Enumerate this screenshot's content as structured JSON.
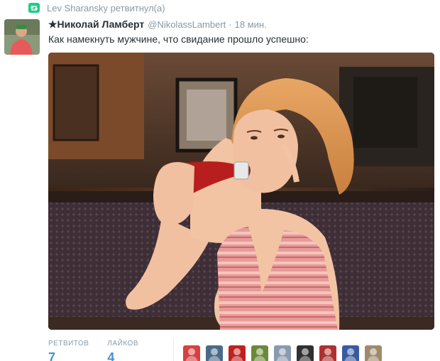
{
  "retweet": {
    "text": "Lev Sharansky ретвитнул(а)",
    "icon": "retweet-icon",
    "color": "#19cf86"
  },
  "tweet": {
    "name": "★Николай Ламберт",
    "handle": "@NikolassLambert",
    "separator": "·",
    "time": "18 мин.",
    "text": "Как намекнуть мужчине, что свидание прошло успешно:"
  },
  "stats": {
    "retweets_label": "РЕТВИТОВ",
    "retweets_value": "7",
    "likes_label": "ЛАЙКОВ",
    "likes_value": "4"
  },
  "likers": [
    {
      "name": "liker-avatar-1",
      "color": "#d84040"
    },
    {
      "name": "liker-avatar-2",
      "color": "#4a6a8a"
    },
    {
      "name": "liker-avatar-3",
      "color": "#c02020"
    },
    {
      "name": "liker-avatar-4",
      "color": "#6a8a3a"
    },
    {
      "name": "liker-avatar-5",
      "color": "#8a9ab0"
    },
    {
      "name": "liker-avatar-6",
      "color": "#303030"
    },
    {
      "name": "liker-avatar-7",
      "color": "#b03030"
    },
    {
      "name": "liker-avatar-8",
      "color": "#3a5aa0"
    },
    {
      "name": "liker-avatar-9",
      "color": "#a08a6a"
    }
  ],
  "colors": {
    "accent": "#4a8fd0",
    "muted": "#8899a6",
    "text": "#292f33"
  }
}
